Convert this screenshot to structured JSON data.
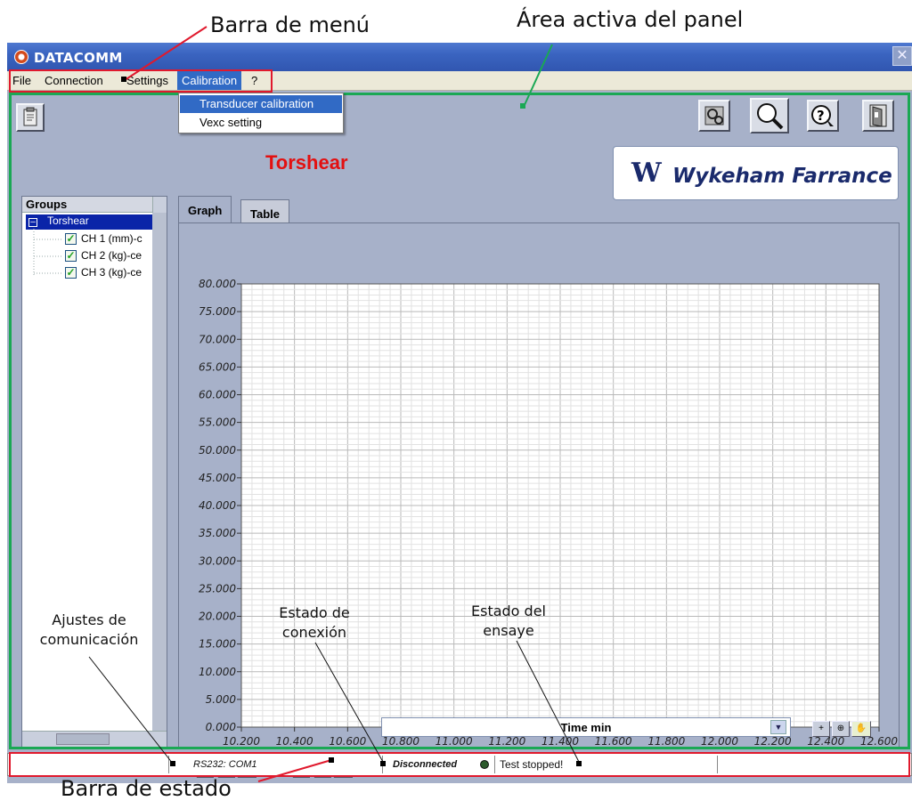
{
  "annotations": {
    "menu_bar": "Barra de menú",
    "active_area": "Área activa del panel",
    "status_bar": "Barra de estado",
    "comm_settings": [
      "Ajustes de",
      "comunicación"
    ],
    "connection_state": [
      "Estado de",
      "conexión"
    ],
    "test_state": [
      "Estado del",
      "ensaye"
    ]
  },
  "window": {
    "title": "DATACOMM",
    "app_icon": "datacomm-logo-icon",
    "close_icon": "close-icon"
  },
  "menu": {
    "items": [
      "File",
      "Connection",
      "Settings",
      "Calibration",
      "?"
    ],
    "active": "Calibration",
    "dropdown": [
      "Transducer calibration",
      "Vexc setting"
    ]
  },
  "toolbar": {
    "left_icon": "clipboard-icon",
    "right_icons": [
      "configure-icon",
      "zoom-icon",
      "help-icon",
      "exit-door-icon"
    ]
  },
  "document_title": "Torshear",
  "logo": {
    "mark": "W",
    "name": "Wykeham Farrance"
  },
  "groups": {
    "header": "Groups",
    "root": "Torshear",
    "channels": [
      "CH 1 (mm)-c",
      "CH 2 (kg)-ce",
      "CH 3 (kg)-ce"
    ]
  },
  "tabs": [
    "Graph",
    "Table"
  ],
  "chart_data": {
    "type": "line",
    "title": "",
    "xlabel": "Time min",
    "ylabel": "",
    "xlim": [
      10.2,
      12.6
    ],
    "ylim": [
      0,
      80
    ],
    "x_ticks": [
      "10.200",
      "10.400",
      "10.600",
      "10.800",
      "11.000",
      "11.200",
      "11.400",
      "11.600",
      "11.800",
      "12.000",
      "12.200",
      "12.400",
      "12.600"
    ],
    "y_ticks": [
      "80.000",
      "75.000",
      "70.000",
      "65.000",
      "60.000",
      "55.000",
      "50.000",
      "45.000",
      "40.000",
      "35.000",
      "30.000",
      "25.000",
      "20.000",
      "15.000",
      "10.000",
      "5.000",
      "0.000"
    ],
    "grid": true,
    "series": []
  },
  "graph_controls": {
    "x_axis": [
      "lock-icon",
      "x-autoscale-icon",
      "x-format-icon"
    ],
    "y_axis": [
      "lock-icon",
      "y-autoscale-icon",
      "y-format-icon"
    ],
    "tools": [
      "crosshair-icon",
      "zoom-icon",
      "pan-hand-icon"
    ]
  },
  "status": {
    "comm": "RS232: COM1",
    "connection": "Disconnected",
    "test": "Test stopped!",
    "led_color": "#2d5a2d"
  }
}
